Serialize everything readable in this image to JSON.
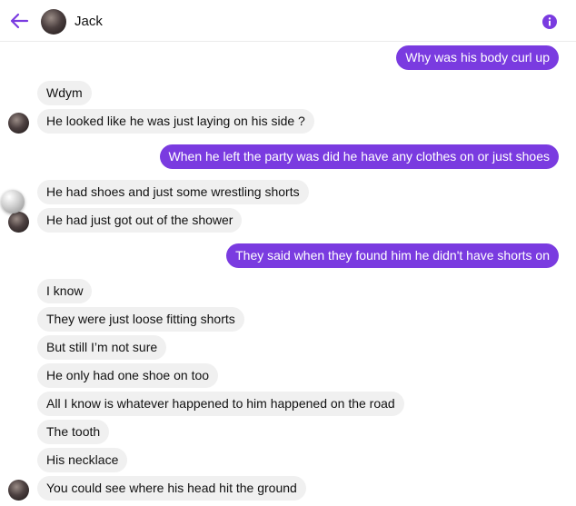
{
  "header": {
    "contact_name": "Jack",
    "back_icon": "arrow-left-icon",
    "info_icon": "info-icon",
    "accent_color": "#7a3be0"
  },
  "messages": [
    {
      "from": "me",
      "text": "Why was his body curl up"
    },
    {
      "from": "Jack",
      "text": "Wdym"
    },
    {
      "from": "Jack",
      "text": "He looked like he was just laying on his side ?"
    },
    {
      "from": "me",
      "text": "When he left the party was did he have any clothes on or just shoes"
    },
    {
      "from": "Jack",
      "text": "He had shoes and just some wrestling shorts"
    },
    {
      "from": "Jack",
      "text": "He had just got out of the shower"
    },
    {
      "from": "me",
      "text": "They said when they found him he didn't have shorts on"
    },
    {
      "from": "Jack",
      "text": "I know"
    },
    {
      "from": "Jack",
      "text": "They were just loose fitting shorts"
    },
    {
      "from": "Jack",
      "text": "But still I’m not sure"
    },
    {
      "from": "Jack",
      "text": "He only had one shoe on too"
    },
    {
      "from": "Jack",
      "text": "All I know is whatever happened to him happened on the road"
    },
    {
      "from": "Jack",
      "text": "The tooth"
    },
    {
      "from": "Jack",
      "text": "His necklace"
    },
    {
      "from": "Jack",
      "text": "You could see where his head hit the ground"
    }
  ]
}
